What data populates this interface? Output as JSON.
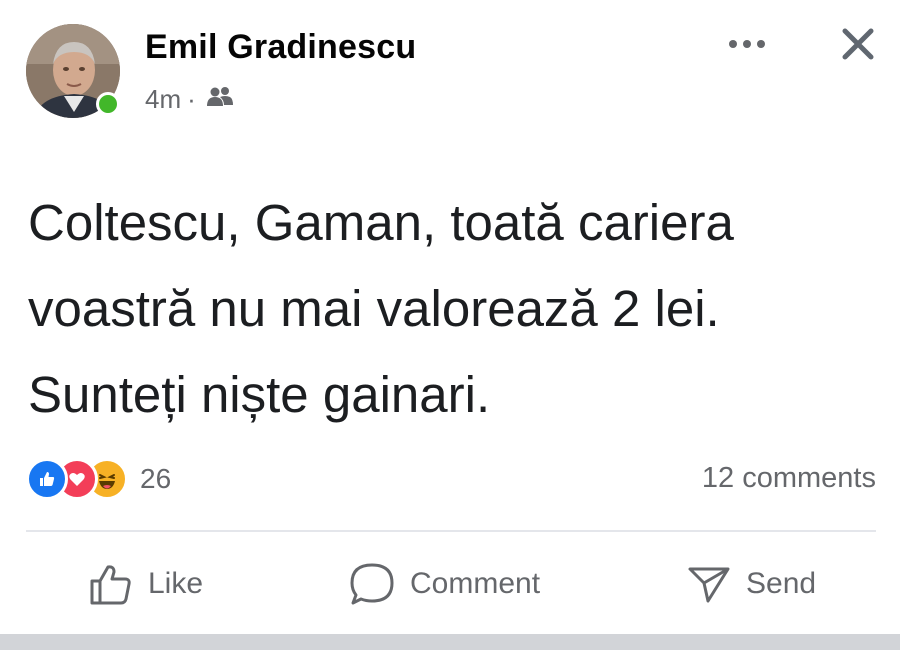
{
  "post": {
    "author": "Emil Gradinescu",
    "time": "4m",
    "separator": "·",
    "audience_icon": "friends-icon",
    "text_lines": [
      "Coltescu, Gaman, toată cariera",
      "voastră nu mai valorează 2 lei.",
      "Sunteți niște gainari."
    ],
    "reactions": {
      "types": [
        "like",
        "love",
        "haha"
      ],
      "count": "26"
    },
    "comments_label": "12 comments"
  },
  "actions": {
    "like_label": "Like",
    "comment_label": "Comment",
    "send_label": "Send"
  },
  "icons": {
    "more": "more-options-icon",
    "close": "close-icon",
    "like": "thumbs-up-icon",
    "comment": "comment-bubble-icon",
    "send": "send-icon"
  },
  "colors": {
    "like_blue": "#1877f2",
    "love_red": "#f33e58",
    "haha_yellow": "#f7b125",
    "online_green": "#42b72a",
    "secondary_text": "#65676b"
  }
}
